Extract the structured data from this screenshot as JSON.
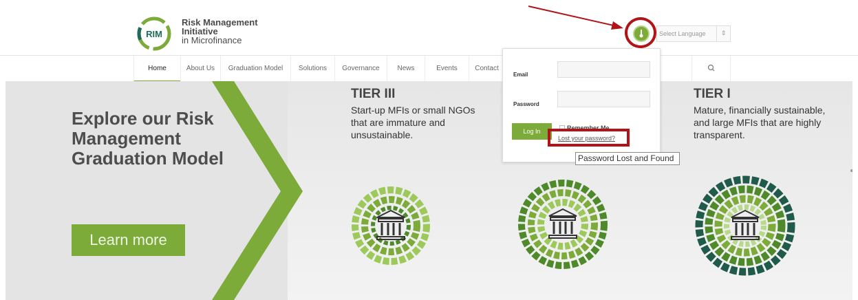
{
  "logo": {
    "badge": "RIM",
    "line1": "Risk Management",
    "line2": "Initiative",
    "line3": "in Microfinance"
  },
  "language_select": {
    "label": "Select Language",
    "caret": "⇕"
  },
  "nav": {
    "items": [
      "Home",
      "About Us",
      "Graduation Model",
      "Solutions",
      "Governance",
      "News",
      "Events",
      "Contact"
    ],
    "active": "Home"
  },
  "hero": {
    "title": "Explore our Risk Management Graduation Model",
    "cta": "Learn more",
    "tiers": [
      {
        "name": "TIER III",
        "desc": "Start-up MFIs or small NGOs that are immature and unsustainable."
      },
      {
        "name": "TIER I",
        "desc": "Mature, financially sustainable, and large MFIs that are highly transparent."
      }
    ]
  },
  "login": {
    "email_label": "Email",
    "password_label": "Password",
    "button": "Log In",
    "remember": "Remember Me",
    "lost_password": "Lost your password?",
    "tooltip": "Password Lost and Found"
  },
  "colors": {
    "brand_green": "#7cab3a",
    "annotation_red": "#b01418"
  }
}
